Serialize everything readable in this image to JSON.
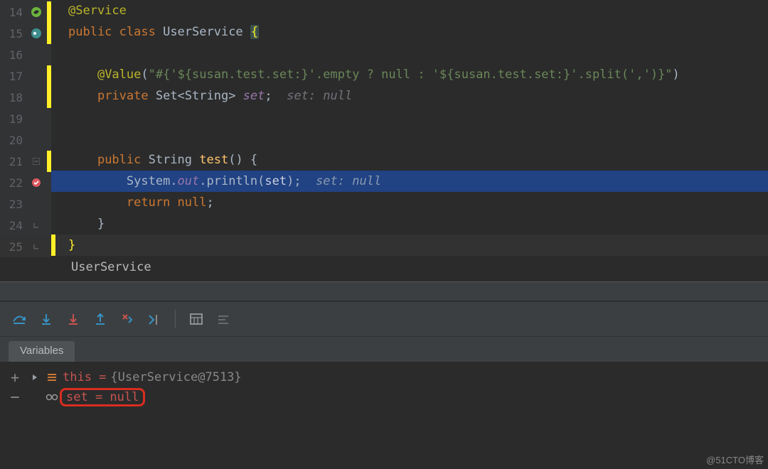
{
  "editor": {
    "lines": [
      {
        "n": 14
      },
      {
        "n": 15
      },
      {
        "n": 16
      },
      {
        "n": 17
      },
      {
        "n": 18
      },
      {
        "n": 19
      },
      {
        "n": 20
      },
      {
        "n": 21
      },
      {
        "n": 22
      },
      {
        "n": 23
      },
      {
        "n": 24
      },
      {
        "n": 25
      }
    ],
    "l14_ann": "@Service",
    "l15_kw1": "public ",
    "l15_kw2": "class ",
    "l15_name": "UserService ",
    "l15_brace": "{",
    "l17_ann": "@Value",
    "l17_p1": "(",
    "l17_str": "\"#{'${susan.test.set:}'.empty ? null : '${susan.test.set:}'.split(',')}\"",
    "l17_p2": ")",
    "l18_kw": "private ",
    "l18_type": "Set<String> ",
    "l18_field": "set",
    "l18_semi": ";",
    "l18_hint": "  set: null",
    "l21_kw": "public ",
    "l21_type": "String ",
    "l21_name": "test",
    "l21_rest": "() {",
    "l22_a": "System.",
    "l22_out": "out",
    "l22_b": ".println(",
    "l22_c": "set",
    "l22_d": ");",
    "l22_hint": "  set: null",
    "l23_kw": "return ",
    "l23_null": "null",
    "l23_semi": ";",
    "l24_brace": "}",
    "l25_brace": "}"
  },
  "crumb": "UserService",
  "vars": {
    "tab": "Variables",
    "thisLabel": "this = ",
    "thisValue": "{UserService@7513}",
    "setText": "set = null"
  },
  "watermark": "@51CTO博客"
}
